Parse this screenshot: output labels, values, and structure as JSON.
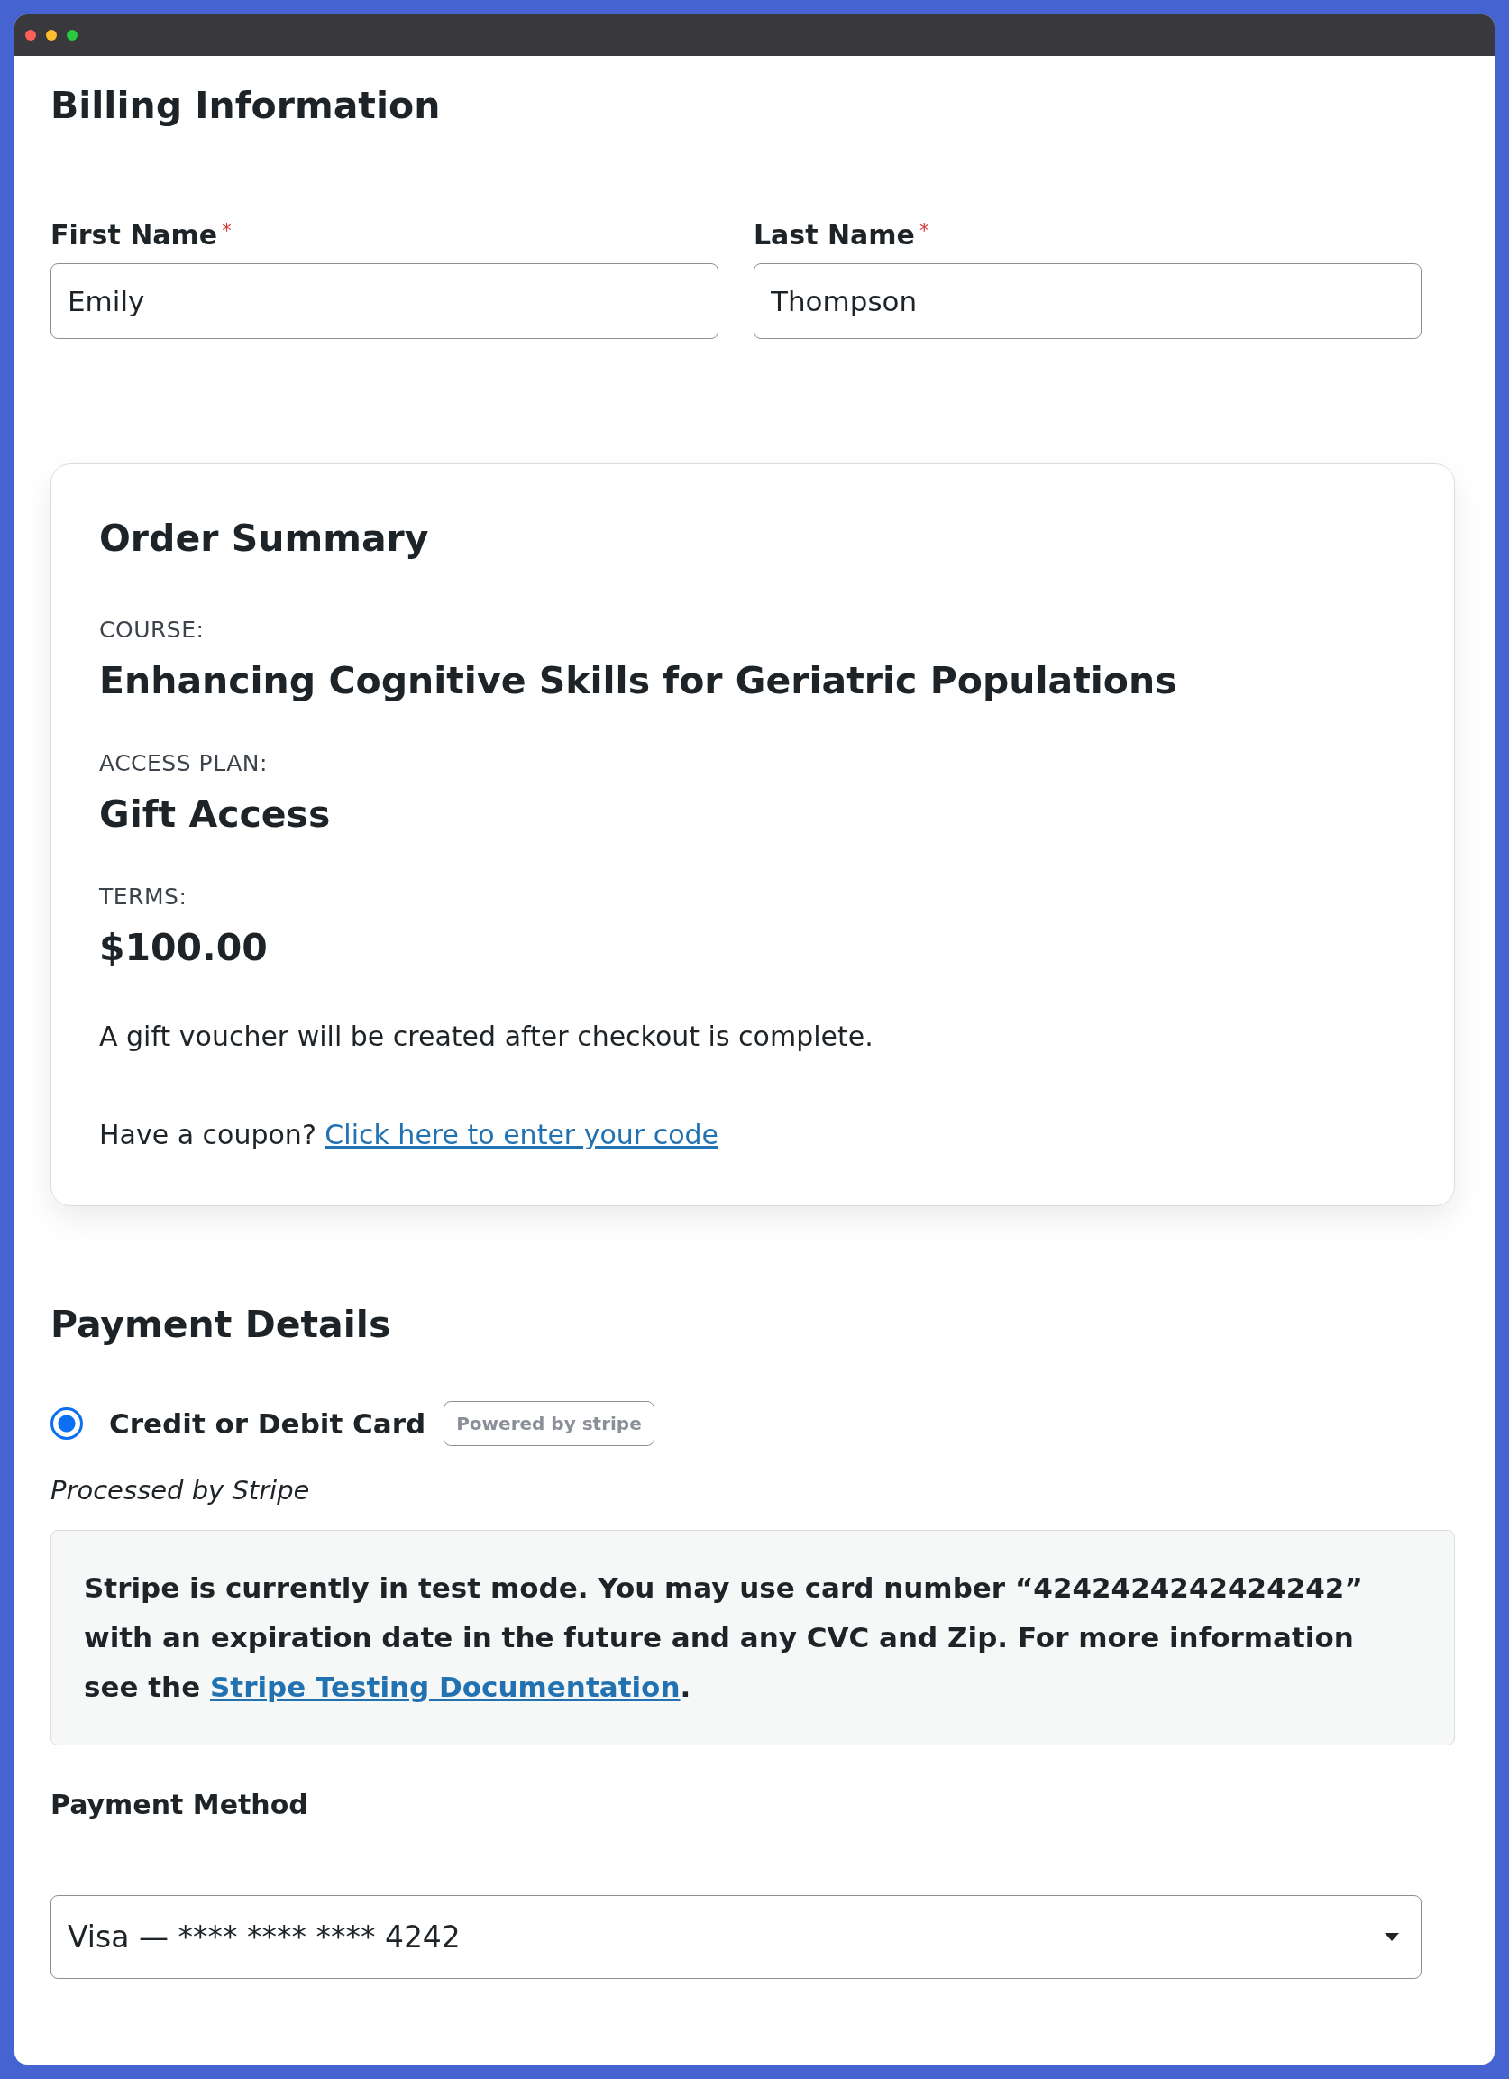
{
  "billing": {
    "title": "Billing Information",
    "fields": [
      {
        "label": "First Name",
        "required_mark": "*",
        "value": "Emily"
      },
      {
        "label": "Last Name",
        "required_mark": "*",
        "value": "Thompson"
      }
    ]
  },
  "order_summary": {
    "title": "Order Summary",
    "items": [
      {
        "label": "COURSE:",
        "value": "Enhancing Cognitive Skills for Geriatric Populations"
      },
      {
        "label": "ACCESS PLAN:",
        "value": "Gift Access"
      },
      {
        "label": "TERMS:",
        "value": "$100.00"
      }
    ],
    "note": "A gift voucher will be created after checkout is complete.",
    "coupon": {
      "prompt": "Have a coupon?",
      "link": "Click here to enter your code"
    }
  },
  "payment": {
    "title": "Payment Details",
    "methods": [
      {
        "label": "Credit or Debit Card",
        "selected": true,
        "badge": "Powered by **stripe**"
      }
    ],
    "processor_note": "Processed by Stripe",
    "notice": {
      "text": "Stripe is currently in test mode. You may use card number “4242424242424242” with an expiration date in the future and any CVC and Zip. For more information see the",
      "link": "Stripe Testing Documentation",
      "end": "."
    },
    "payment_method": {
      "label": "Payment Method",
      "value": "Visa — **** **** **** 4242"
    }
  }
}
